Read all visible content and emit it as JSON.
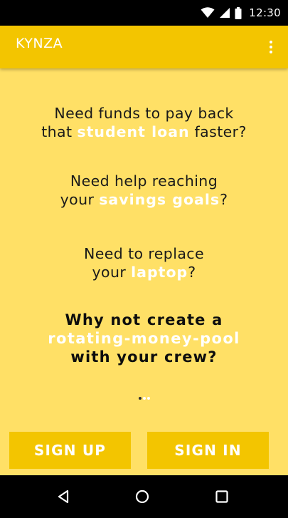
{
  "status_bar": {
    "time": "12:30",
    "icons": [
      "wifi-icon",
      "signal-icon",
      "battery-icon"
    ]
  },
  "app_bar": {
    "title": "KYNZA",
    "overflow_icon": "more-vert-icon"
  },
  "messages": [
    {
      "lines": [
        {
          "pre": "Need funds to pay back",
          "hl": "",
          "post": ""
        },
        {
          "pre": "that ",
          "hl": "student loan",
          "post": " faster?"
        }
      ]
    },
    {
      "lines": [
        {
          "pre": "Need help reaching",
          "hl": "",
          "post": ""
        },
        {
          "pre": "your ",
          "hl": "savings goals",
          "post": "?"
        }
      ]
    },
    {
      "lines": [
        {
          "pre": "Need to replace",
          "hl": "",
          "post": ""
        },
        {
          "pre": "your ",
          "hl": "laptop",
          "post": "?"
        }
      ]
    },
    {
      "lines": [
        {
          "pre": "Why not create a",
          "hl": "",
          "post": ""
        },
        {
          "pre": "",
          "hl": "rotating-money-pool",
          "post": ""
        },
        {
          "pre": "with your  crew?",
          "hl": "",
          "post": ""
        }
      ]
    }
  ],
  "pager": {
    "total": 3,
    "current": 1
  },
  "buttons": {
    "sign_up": "SIGN UP",
    "sign_in": "SIGN IN"
  },
  "nav_bar": {
    "back_icon": "back-icon",
    "home_icon": "home-icon",
    "recents_icon": "recents-icon"
  },
  "colors": {
    "app_bar": "#f3c500",
    "background": "#ffe066",
    "highlight": "#ffffff",
    "text": "#1a1a1a"
  }
}
